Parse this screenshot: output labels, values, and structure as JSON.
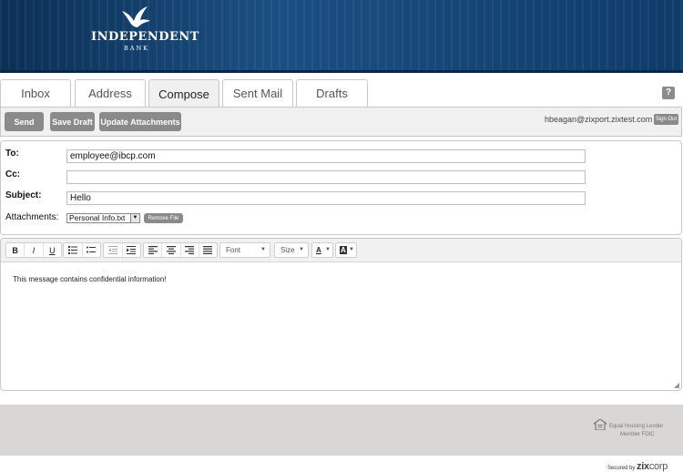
{
  "brand": {
    "name": "INDEPENDENT",
    "sub": "BANK"
  },
  "tabs": [
    {
      "label": "Inbox"
    },
    {
      "label": "Address"
    },
    {
      "label": "Compose"
    },
    {
      "label": "Sent Mail"
    },
    {
      "label": "Drafts"
    }
  ],
  "active_tab": "Compose",
  "help": {
    "label": "?"
  },
  "toolbar": {
    "send_label": "Send",
    "save_draft_label": "Save Draft",
    "update_attachments_label": "Update Attachments",
    "user_email": "hbeagan@zixport.zixtest.com",
    "sign_out_label": "Sign Out"
  },
  "form": {
    "to_label": "To:",
    "to_value": "employee@ibcp.com",
    "cc_label": "Cc:",
    "cc_value": "",
    "subject_label": "Subject:",
    "subject_value": "Hello",
    "attachments_label": "Attachments:",
    "attachment_selected": "Personal Info.txt",
    "remove_file_label": "Remove File"
  },
  "editor": {
    "bold": "B",
    "italic": "I",
    "underline": "U",
    "font_label": "Font",
    "size_label": "Size",
    "text_color": "A",
    "bg_color": "A",
    "message": "This message contains confidential information!"
  },
  "footer": {
    "ehl_line1": "Equal Housing Lender",
    "ehl_line2": "Member FDIC",
    "secured_by": "Secured by",
    "brand_zix": "zix",
    "brand_corp": "corp"
  },
  "colors": {
    "banner": "#1b4f82",
    "button_gray": "#8a8a8a",
    "footer_bg": "#d9d6d6"
  }
}
